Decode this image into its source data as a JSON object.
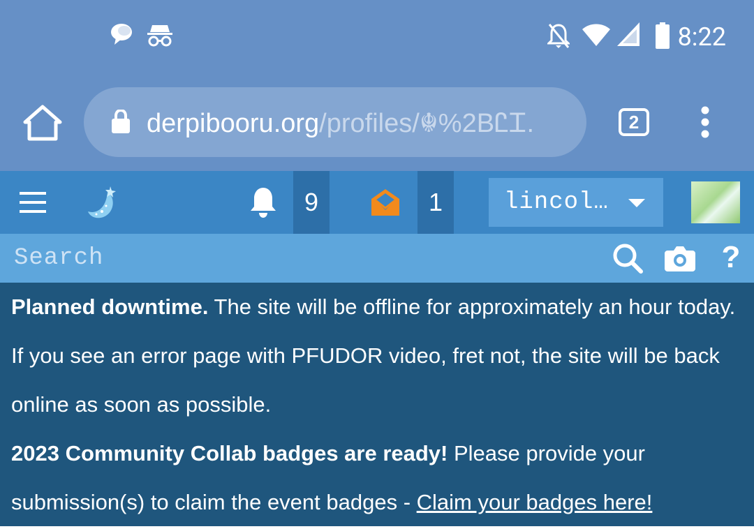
{
  "status_bar": {
    "time": "8:22",
    "icons": [
      "chat-bubble-icon",
      "incognito-icon",
      "notifications-off-icon",
      "wifi-icon",
      "cell-signal-icon",
      "battery-icon"
    ]
  },
  "browser": {
    "url_host": "derpibooru.org",
    "url_path": "/profiles/☬%2BᏝᏆ.",
    "tab_count": "2",
    "icons": [
      "home-icon",
      "lock-icon",
      "overflow-menu-icon"
    ]
  },
  "site_header": {
    "notification_count": "9",
    "message_count": "1",
    "username": "lincol…",
    "icons": [
      "hamburger-menu-icon",
      "site-logo-icon",
      "bell-icon",
      "envelope-icon",
      "avatar"
    ]
  },
  "search": {
    "placeholder": "Search",
    "help_label": "?"
  },
  "notice": {
    "downtime_title": "Planned downtime.",
    "downtime_text": " The site will be offline for approximately an hour today. If you see an error page with PFUDOR video, fret not, the site will be back online as soon as possible.",
    "collab_title": "2023 Community Collab badges are ready!",
    "collab_text": " Please provide your submission(s) to claim the event badges - ",
    "collab_link": "Claim your badges here!"
  },
  "colors": {
    "status_bar": "#6690c6",
    "site_header": "#3b86c5",
    "search_bar": "#5ea6dc",
    "notice_bg": "#1f567d",
    "envelope": "#f28a1c"
  }
}
